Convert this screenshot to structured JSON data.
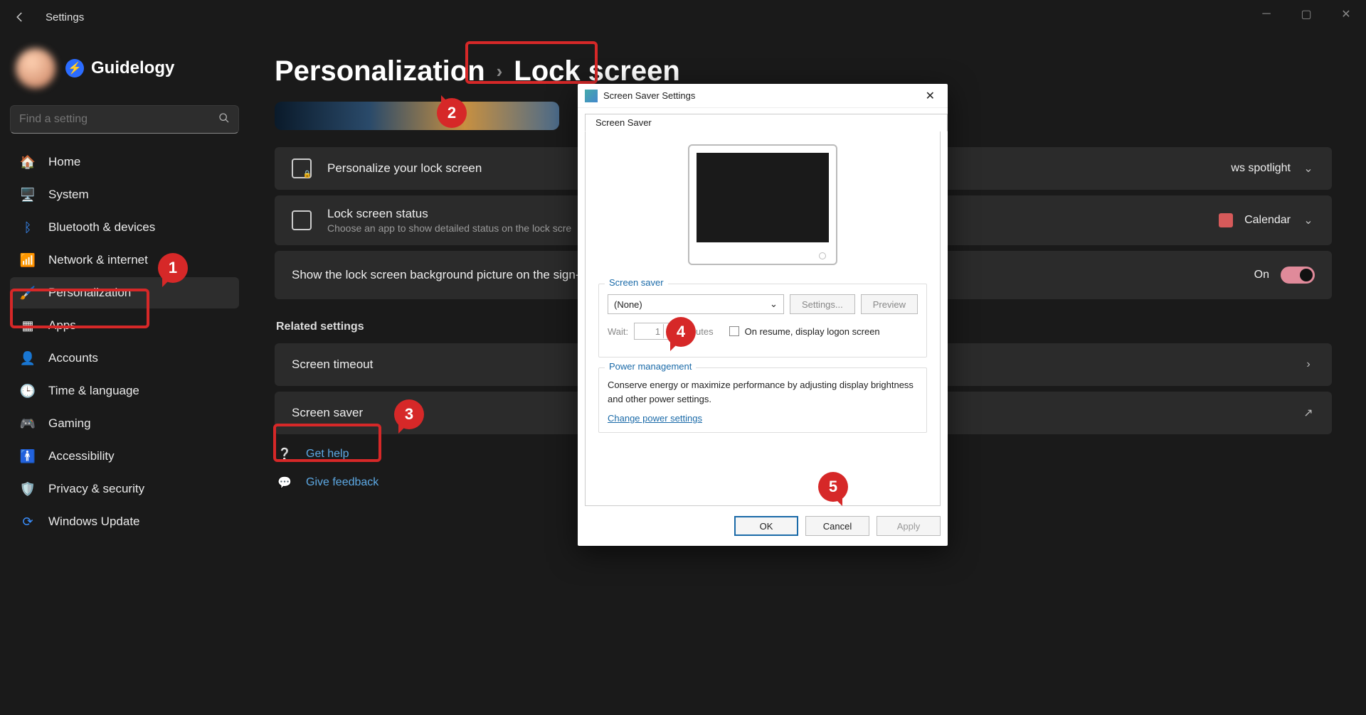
{
  "window": {
    "title": "Settings"
  },
  "user": {
    "brand": "Guidelogy"
  },
  "search": {
    "placeholder": "Find a setting"
  },
  "nav": {
    "home": "Home",
    "system": "System",
    "bluetooth": "Bluetooth & devices",
    "network": "Network & internet",
    "personalization": "Personalization",
    "apps": "Apps",
    "accounts": "Accounts",
    "time": "Time & language",
    "gaming": "Gaming",
    "accessibility": "Accessibility",
    "privacy": "Privacy & security",
    "update": "Windows Update"
  },
  "breadcrumb": {
    "parent": "Personalization",
    "current": "Lock screen"
  },
  "cards": {
    "personalize": {
      "title": "Personalize your lock screen"
    },
    "spotlight_value": "ws spotlight",
    "status": {
      "title": "Lock screen status",
      "sub": "Choose an app to show detailed status on the lock scre"
    },
    "calendar_value": "Calendar",
    "bg": {
      "title": "Show the lock screen background picture on the sign-i",
      "state": "On"
    }
  },
  "related": {
    "heading": "Related settings",
    "timeout": "Screen timeout",
    "screensaver": "Screen saver"
  },
  "help": {
    "get": "Get help",
    "feedback": "Give feedback"
  },
  "dialog": {
    "title": "Screen Saver Settings",
    "tab": "Screen Saver",
    "group_label": "Screen saver",
    "dropdown_value": "(None)",
    "settings_btn": "Settings...",
    "preview_btn": "Preview",
    "wait_label": "Wait:",
    "wait_value": "1",
    "minutes": "minutes",
    "resume_label": "On resume, display logon screen",
    "power_heading": "Power management",
    "power_text": "Conserve energy or maximize performance by adjusting display brightness and other power settings.",
    "power_link": "Change power settings",
    "ok": "OK",
    "cancel": "Cancel",
    "apply": "Apply"
  },
  "annotations": {
    "n1": "1",
    "n2": "2",
    "n3": "3",
    "n4": "4",
    "n5": "5"
  }
}
